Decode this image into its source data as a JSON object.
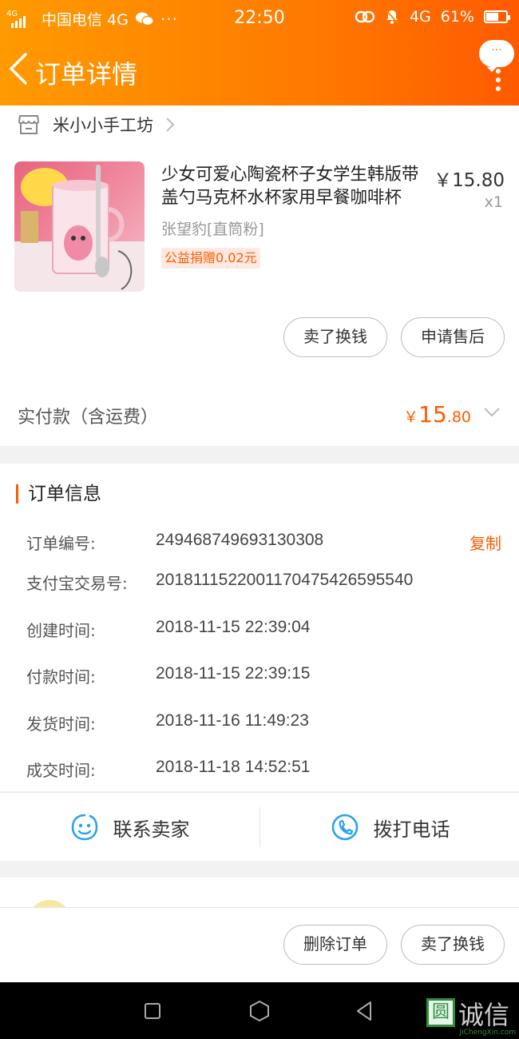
{
  "status_bar": {
    "network_type": "4G",
    "carrier": "中国电信 4G",
    "time": "22:50",
    "right_network": "4G",
    "battery": "61%",
    "battery_level": 0.61
  },
  "header": {
    "title": "订单详情",
    "message_badge": "···"
  },
  "shop": {
    "name": "米小小手工坊"
  },
  "product": {
    "title": "少女可爱心陶瓷杯子女学生韩版带盖勺马克杯水杯家用早餐咖啡杯",
    "price": "￥15.80",
    "quantity": "x1",
    "sku": "张望豹[直筒粉]",
    "badge": "公益捐赠0.02元"
  },
  "product_actions": {
    "sell": "卖了换钱",
    "after_sale": "申请售后"
  },
  "payment": {
    "label": "实付款（含运费）",
    "currency": "￥",
    "amount_int": "15",
    "amount_dec": ".80"
  },
  "order_info": {
    "title": "订单信息",
    "copy_label": "复制",
    "rows": [
      {
        "label": "订单编号:",
        "value": "249468749693130308"
      },
      {
        "label": "支付宝交易号:",
        "value": "2018111522001170475426595540"
      },
      {
        "label": "创建时间:",
        "value": "2018-11-15 22:39:04"
      },
      {
        "label": "付款时间:",
        "value": "2018-11-15 22:39:15"
      },
      {
        "label": "发货时间:",
        "value": "2018-11-16 11:49:23"
      },
      {
        "label": "成交时间:",
        "value": "2018-11-18 14:52:51"
      }
    ]
  },
  "contact": {
    "seller": "联系卖家",
    "call": "拨打电话"
  },
  "bottom_actions": {
    "delete": "删除订单",
    "sell": "卖了换钱"
  },
  "watermark": {
    "mark": "圆",
    "text": "诚信",
    "sub": "JiChengXin.com"
  },
  "colors": {
    "accent": "#ff5a00",
    "header_start": "#ff9a00",
    "header_end": "#ff5a00",
    "contact_icon": "#29a1f0"
  }
}
